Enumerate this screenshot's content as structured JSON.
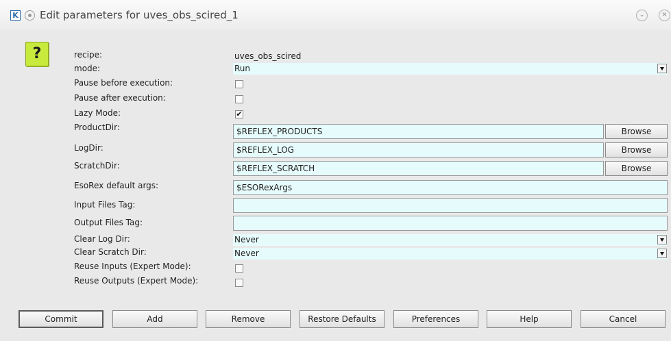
{
  "window": {
    "title": "Edit parameters for uves_obs_scired_1",
    "app_icon_letter": "K"
  },
  "help": {
    "glyph": "?"
  },
  "params": {
    "recipe": {
      "label": "recipe:",
      "value": "uves_obs_scired"
    },
    "mode": {
      "label": "mode:",
      "value": "Run"
    },
    "pause_before": {
      "label": "Pause before execution:",
      "checked": false
    },
    "pause_after": {
      "label": "Pause after execution:",
      "checked": false
    },
    "lazy_mode": {
      "label": "Lazy Mode:",
      "checked": true,
      "glyph": "✔"
    },
    "product_dir": {
      "label": "ProductDir:",
      "value": "$REFLEX_PRODUCTS",
      "browse_label": "Browse"
    },
    "log_dir": {
      "label": "LogDir:",
      "value": "$REFLEX_LOG",
      "browse_label": "Browse"
    },
    "scratch_dir": {
      "label": "ScratchDir:",
      "value": "$REFLEX_SCRATCH",
      "browse_label": "Browse"
    },
    "esorex_args": {
      "label": "EsoRex default args:",
      "value": "$ESORexArgs"
    },
    "input_files_tag": {
      "label": "Input Files Tag:",
      "value": ""
    },
    "output_files_tag": {
      "label": "Output Files Tag:",
      "value": ""
    },
    "clear_log_dir": {
      "label": "Clear Log Dir:",
      "value": "Never"
    },
    "clear_scratch_dir": {
      "label": "Clear Scratch Dir:",
      "value": "Never"
    },
    "reuse_inputs": {
      "label": "Reuse Inputs (Expert Mode):",
      "checked": false
    },
    "reuse_outputs": {
      "label": "Reuse Outputs (Expert Mode):",
      "checked": false
    }
  },
  "buttons": {
    "commit": "Commit",
    "add": "Add",
    "remove": "Remove",
    "restore_defaults": "Restore Defaults",
    "preferences": "Preferences",
    "help": "Help",
    "cancel": "Cancel"
  },
  "colors": {
    "field_background": "#e6fbfb",
    "help_icon": "#c7ea3c"
  }
}
